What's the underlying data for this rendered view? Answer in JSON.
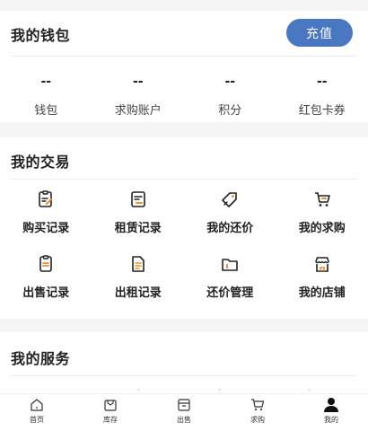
{
  "wallet": {
    "title": "我的钱包",
    "recharge_label": "充值",
    "stats": [
      {
        "value": "--",
        "label": "钱包"
      },
      {
        "value": "--",
        "label": "求购账户"
      },
      {
        "value": "--",
        "label": "积分"
      },
      {
        "value": "--",
        "label": "红包卡券"
      }
    ]
  },
  "trade": {
    "title": "我的交易",
    "items": [
      {
        "label": "购买记录",
        "icon": "purchase-record-icon"
      },
      {
        "label": "租赁记录",
        "icon": "lease-record-icon"
      },
      {
        "label": "我的还价",
        "icon": "counter-offer-icon"
      },
      {
        "label": "我的求购",
        "icon": "want-to-buy-icon"
      },
      {
        "label": "出售记录",
        "icon": "sale-record-icon"
      },
      {
        "label": "出租记录",
        "icon": "rental-record-icon"
      },
      {
        "label": "还价管理",
        "icon": "offer-management-icon"
      },
      {
        "label": "我的店铺",
        "icon": "store-icon"
      }
    ]
  },
  "service": {
    "title": "我的服务"
  },
  "tabbar": {
    "items": [
      {
        "label": "首页",
        "icon": "home-icon"
      },
      {
        "label": "库存",
        "icon": "inventory-icon"
      },
      {
        "label": "出售",
        "icon": "sell-icon"
      },
      {
        "label": "求购",
        "icon": "cart-icon"
      },
      {
        "label": "我的",
        "icon": "profile-icon",
        "active": true
      }
    ]
  },
  "colors": {
    "accent": "#4a77c1",
    "icon_orange": "#e8912f",
    "text": "#222222",
    "background": "#f5f5f5"
  }
}
